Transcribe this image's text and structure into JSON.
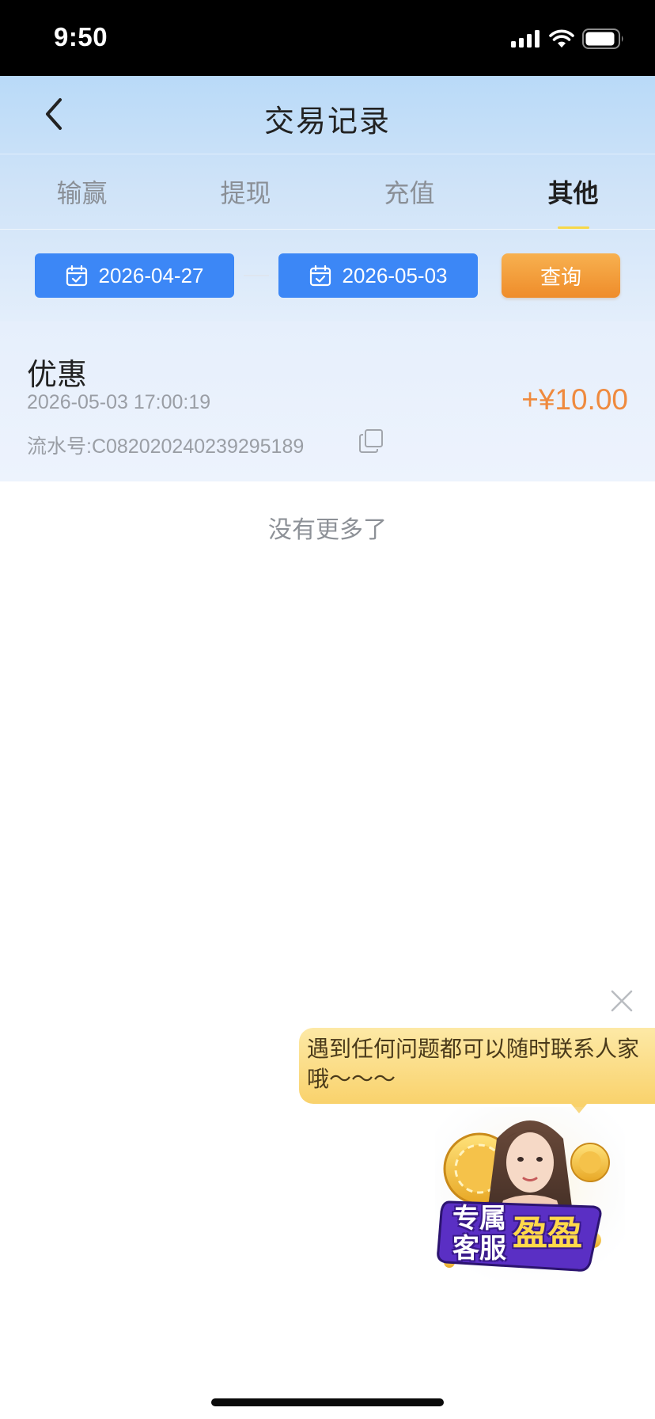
{
  "status_bar": {
    "time": "9:50"
  },
  "nav": {
    "title": "交易记录",
    "back_icon": "chevron-left-icon"
  },
  "tabs": [
    {
      "label": "输赢",
      "active": false
    },
    {
      "label": "提现",
      "active": false
    },
    {
      "label": "充值",
      "active": false
    },
    {
      "label": "其他",
      "active": true
    }
  ],
  "filter": {
    "start_date": "2026-04-27",
    "end_date": "2026-05-03",
    "query_label": "查询",
    "date_icon": "calendar-check-icon"
  },
  "records": [
    {
      "title": "优惠",
      "time": "2026-05-03 17:00:19",
      "serial": "流水号:C082020240239295189",
      "amount": "+¥10.00"
    }
  ],
  "no_more": "没有更多了",
  "customer_service": {
    "message": "遇到任何问题都可以随时联系人家哦～～～",
    "badge_line1": "专属",
    "badge_line2": "客服",
    "badge_name": "盈盈"
  },
  "colors": {
    "primary_blue": "#3c87f6",
    "query_orange": "#ef8c2a",
    "amount_orange": "#ef8a3e",
    "tab_underline": "#f6d84a",
    "bubble_yellow": "#f9d26c"
  }
}
